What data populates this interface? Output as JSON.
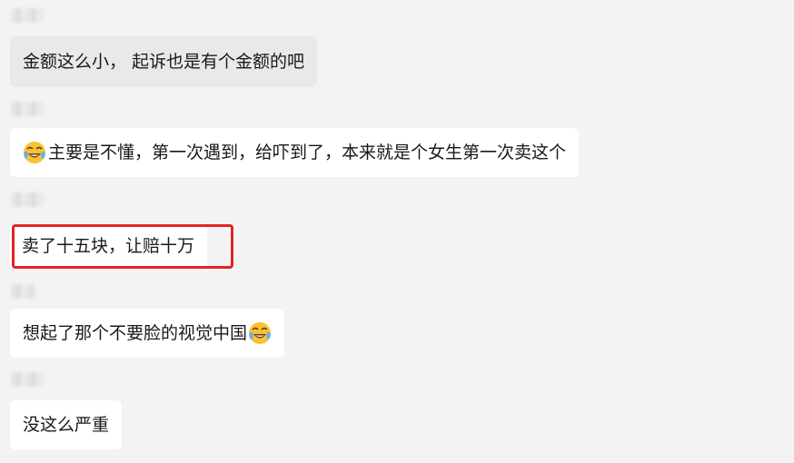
{
  "messages": [
    {
      "text": "金额这么小， 起诉也是有个金额的吧",
      "emoji": null,
      "highlighted": false,
      "bubble_color": "#e9e9e9"
    },
    {
      "text": "主要是不懂，第一次遇到，给吓到了，本来就是个女生第一次卖这个",
      "emoji": "laugh-cry-icon",
      "emoji_position": "start",
      "highlighted": false,
      "bubble_color": "#ffffff"
    },
    {
      "text": "卖了十五块，让赔十万",
      "emoji": null,
      "highlighted": true,
      "bubble_color": "#ffffff"
    },
    {
      "text": "想起了那个不要脸的视觉中国",
      "emoji": "laugh-cry-icon",
      "emoji_position": "end",
      "highlighted": false,
      "bubble_color": "#ffffff"
    },
    {
      "text": "没这么严重",
      "emoji": null,
      "highlighted": false,
      "bubble_color": "#ffffff"
    }
  ],
  "highlight_color": "#e52323",
  "background_color": "#f3f3f3"
}
